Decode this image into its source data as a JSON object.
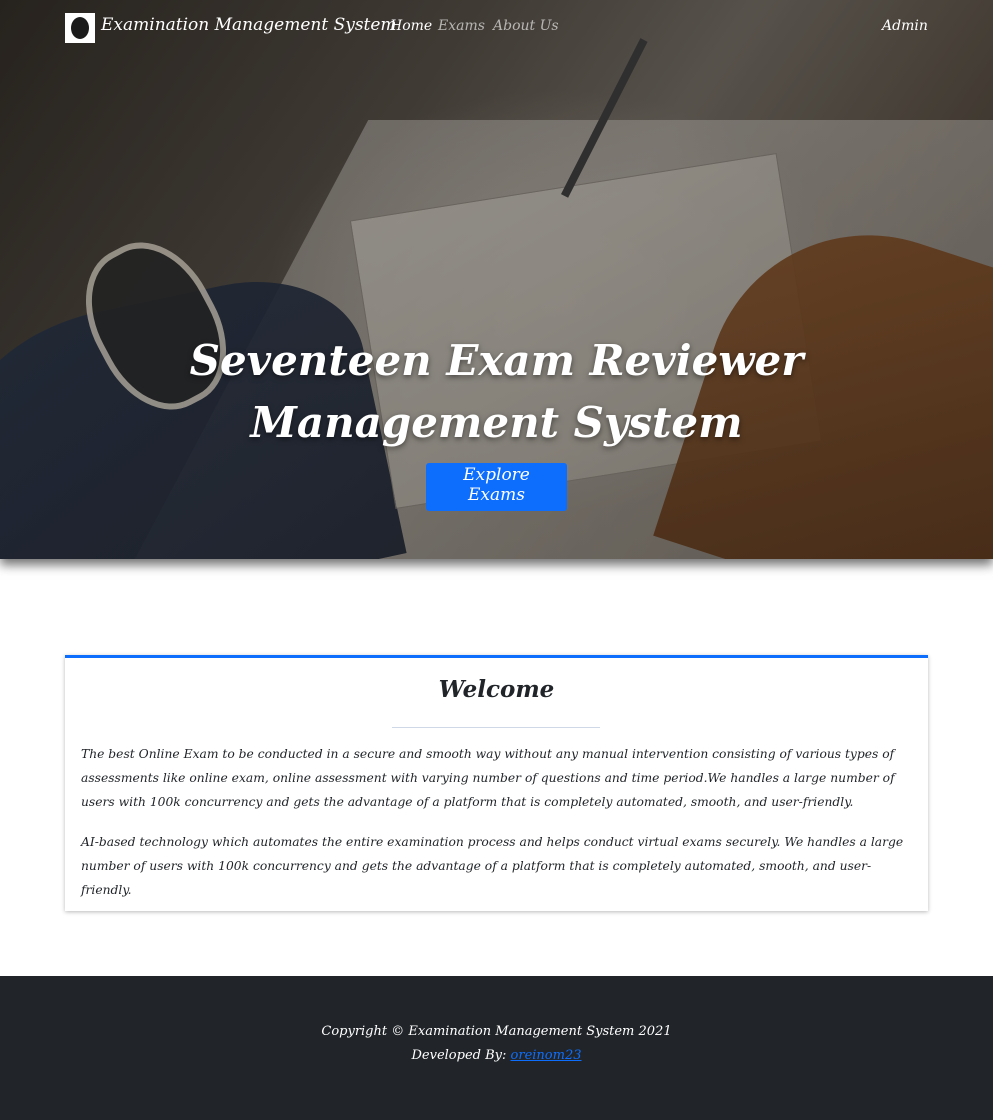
{
  "navbar": {
    "brand": "Examination Management System",
    "logo_icon": "school-crest-logo-icon",
    "links": [
      {
        "label": "Home",
        "active": true
      },
      {
        "label": "Exams",
        "active": false
      },
      {
        "label": "About Us",
        "active": false
      }
    ],
    "admin_label": "Admin"
  },
  "hero": {
    "title": "Seventeen Exam Reviewer Management System",
    "button_label": "Explore Exams",
    "button_color": "#0d6efd"
  },
  "welcome": {
    "title": "Welcome",
    "paragraphs": [
      "The best Online Exam to be conducted in a secure and smooth way without any manual intervention consisting of various types of assessments like online exam, online assessment with varying number of questions and time period.We handles a large number of users with 100k concurrency and gets the advantage of a platform that is completely automated, smooth, and user-friendly.",
      "AI-based technology which automates the entire examination process and helps conduct virtual exams securely. We handles a large number of users with 100k concurrency and gets the advantage of a platform that is completely automated, smooth, and user-friendly."
    ],
    "accent_color": "#0d6efd"
  },
  "footer": {
    "copyright": "Copyright © Examination Management System 2021",
    "developed_prefix": "Developed By:",
    "developer_link": "oreinom23",
    "background": "#212529"
  }
}
